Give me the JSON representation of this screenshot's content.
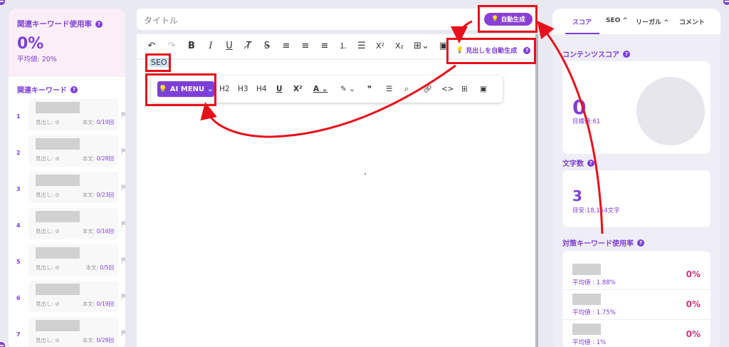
{
  "left": {
    "usage_title": "関連キーワード使用率",
    "usage_pct": "0%",
    "usage_avg": "平均値: 20%",
    "keywords_title": "関連キーワード",
    "keywords": [
      {
        "num": "1",
        "heading": "見出し: ⊘",
        "body": "本文: ",
        "count": "0/19回"
      },
      {
        "num": "2",
        "heading": "見出し: ⊘",
        "body": "本文: ",
        "count": "0/28回"
      },
      {
        "num": "3",
        "heading": "見出し: ⊘",
        "body": "本文: ",
        "count": "0/23回"
      },
      {
        "num": "4",
        "heading": "見出し: ⊘",
        "body": "本文: ",
        "count": "0/16回"
      },
      {
        "num": "5",
        "heading": "見出し: ⊘",
        "body": "本文: ",
        "count": "0/5回"
      },
      {
        "num": "6",
        "heading": "見出し: ⊘",
        "body": "本文: ",
        "count": "0/19回"
      },
      {
        "num": "7",
        "heading": "見出し: ⊘",
        "body": "本文: ",
        "count": "0/28回"
      }
    ]
  },
  "editor": {
    "title_placeholder": "タイトル",
    "auto_generate_label": "自動生成",
    "heading_auto_label": "見出しを自動生成",
    "content_text": "SEO",
    "ai_menu_label": "AI MENU",
    "bubble_items": [
      "H2",
      "H3",
      "H4"
    ]
  },
  "right": {
    "tabs": [
      "スコア",
      "SEO ^",
      "リーガル ^",
      "コメント"
    ],
    "score_title": "コンテンツスコア",
    "score_value": "0",
    "score_target": "目標値:61",
    "wordcount_title": "文字数",
    "wordcount_value": "3",
    "wordcount_target": "目安:18,154文字",
    "target_kw_title": "対策キーワード使用率",
    "target_keywords": [
      {
        "avg": "平均値 : 1.88%",
        "pct": "0%"
      },
      {
        "avg": "平均値 : 1.75%",
        "pct": "0%"
      },
      {
        "avg": "平均値 : 1%",
        "pct": "0%"
      }
    ]
  },
  "colors": {
    "accent": "#7d3fd8",
    "pink": "#d1357e",
    "annotation_red": "#e8101a"
  }
}
